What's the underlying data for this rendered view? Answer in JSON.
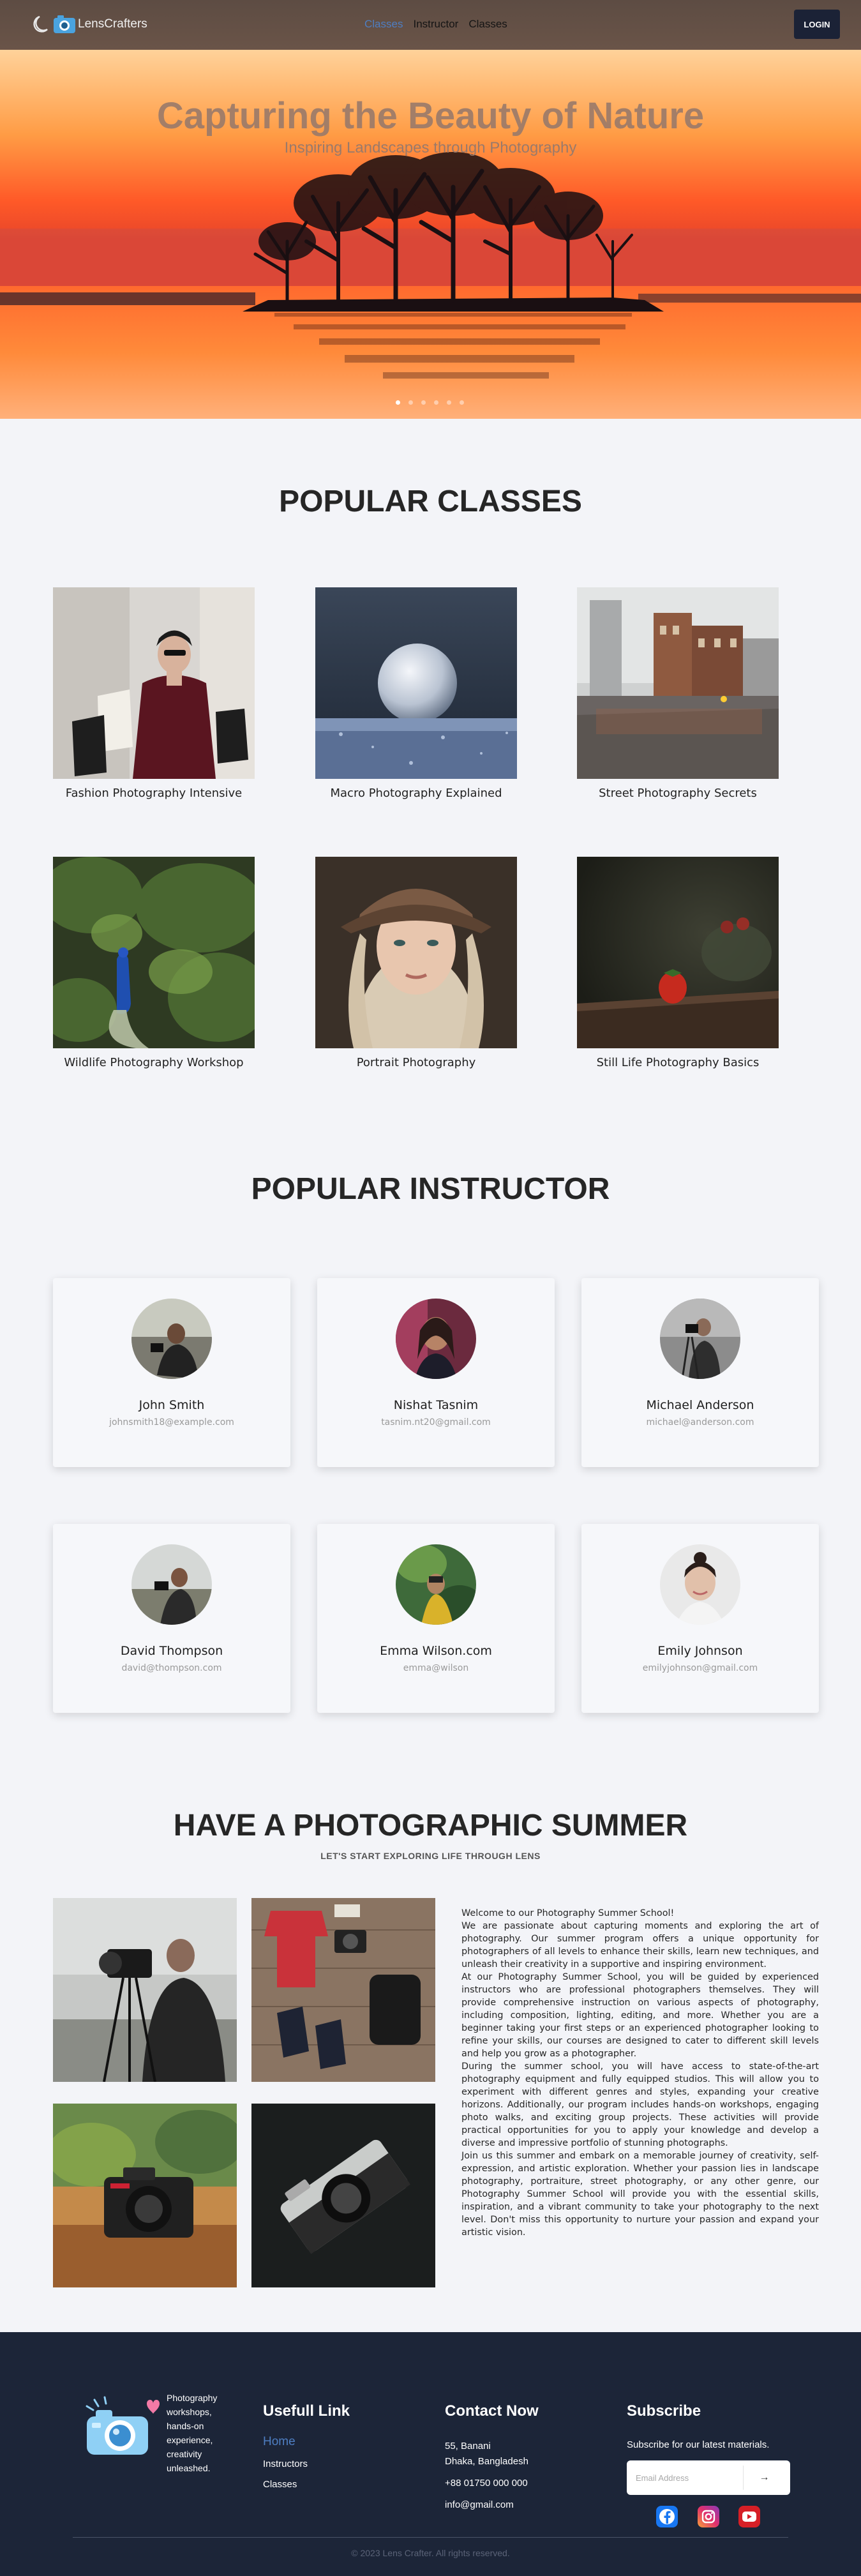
{
  "nav": {
    "brand": "LensCrafters",
    "links": [
      {
        "label": "Classes"
      },
      {
        "label": "Instructor"
      },
      {
        "label": "Classes"
      }
    ],
    "login": "LOGIN"
  },
  "hero": {
    "title": "Capturing the Beauty of Nature",
    "subtitle": "Inspiring Landscapes through Photography",
    "slides_total": 6,
    "active_slide": 1
  },
  "classes": {
    "title": "POPULAR CLASSES",
    "items": [
      {
        "name": "Fashion Photography Intensive"
      },
      {
        "name": "Macro Photography Explained"
      },
      {
        "name": "Street Photography Secrets"
      },
      {
        "name": "Wildlife Photography Workshop"
      },
      {
        "name": "Portrait Photography"
      },
      {
        "name": "Still Life Photography Basics"
      }
    ]
  },
  "instructors": {
    "title": "POPULAR INSTRUCTOR",
    "items": [
      {
        "name": "John Smith",
        "email": "johnsmith18@example.com"
      },
      {
        "name": "Nishat Tasnim",
        "email": "tasnim.nt20@gmail.com"
      },
      {
        "name": "Michael Anderson",
        "email": "michael@anderson.com"
      },
      {
        "name": "David Thompson",
        "email": "david@thompson.com"
      },
      {
        "name": "Emma Wilson.com",
        "email": "emma@wilson"
      },
      {
        "name": "Emily Johnson",
        "email": "emilyjohnson@gmail.com"
      }
    ]
  },
  "summer": {
    "title": "HAVE A PHOTOGRAPHIC SUMMER",
    "subtitle": "LET'S START EXPLORING LIFE THROUGH LENS",
    "paragraphs": [
      "Welcome to our Photography Summer School!",
      "We are passionate about capturing moments and exploring the art of photography. Our summer program offers a unique opportunity for photographers of all levels to enhance their skills, learn new techniques, and unleash their creativity in a supportive and inspiring environment.",
      "At our Photography Summer School, you will be guided by experienced instructors who are professional photographers themselves. They will provide comprehensive instruction on various aspects of photography, including composition, lighting, editing, and more. Whether you are a beginner taking your first steps or an experienced photographer looking to refine your skills, our courses are designed to cater to different skill levels and help you grow as a photographer.",
      "During the summer school, you will have access to state-of-the-art photography equipment and fully equipped studios. This will allow you to experiment with different genres and styles, expanding your creative horizons. Additionally, our program includes hands-on workshops, engaging photo walks, and exciting group projects. These activities will provide practical opportunities for you to apply your knowledge and develop a diverse and impressive portfolio of stunning photographs.",
      "Join us this summer and embark on a memorable journey of creativity, self-expression, and artistic exploration. Whether your passion lies in landscape photography, portraiture, street photography, or any other genre, our Photography Summer School will provide you with the essential skills, inspiration, and a vibrant community to take your photography to the next level. Don't miss this opportunity to nurture your passion and expand your artistic vision."
    ]
  },
  "footer": {
    "tagline": "Photography workshops, hands-on experience, creativity unleashed.",
    "links_title": "Usefull Link",
    "links": [
      {
        "label": "Home"
      },
      {
        "label": "Instructors"
      },
      {
        "label": "Classes"
      }
    ],
    "contact_title": "Contact Now",
    "address_line1": "55, Banani",
    "address_line2": "Dhaka, Bangladesh",
    "phone": "+88 01750 000 000",
    "email": "info@gmail.com",
    "subscribe_title": "Subscribe",
    "subscribe_text": "Subscribe for our latest materials.",
    "email_placeholder": "Email Address",
    "submit_icon": "→",
    "copyright": "© 2023 Lens Crafter. All rights reserved.",
    "social_icons": [
      "facebook-icon",
      "instagram-icon",
      "youtube-icon"
    ]
  },
  "colors": {
    "nav_bg": "#5d4c43",
    "accent": "#4e7ec2",
    "login_bg": "#1b2236",
    "footer_bg": "#1c2538",
    "page_bg": "#f3f4f8"
  }
}
